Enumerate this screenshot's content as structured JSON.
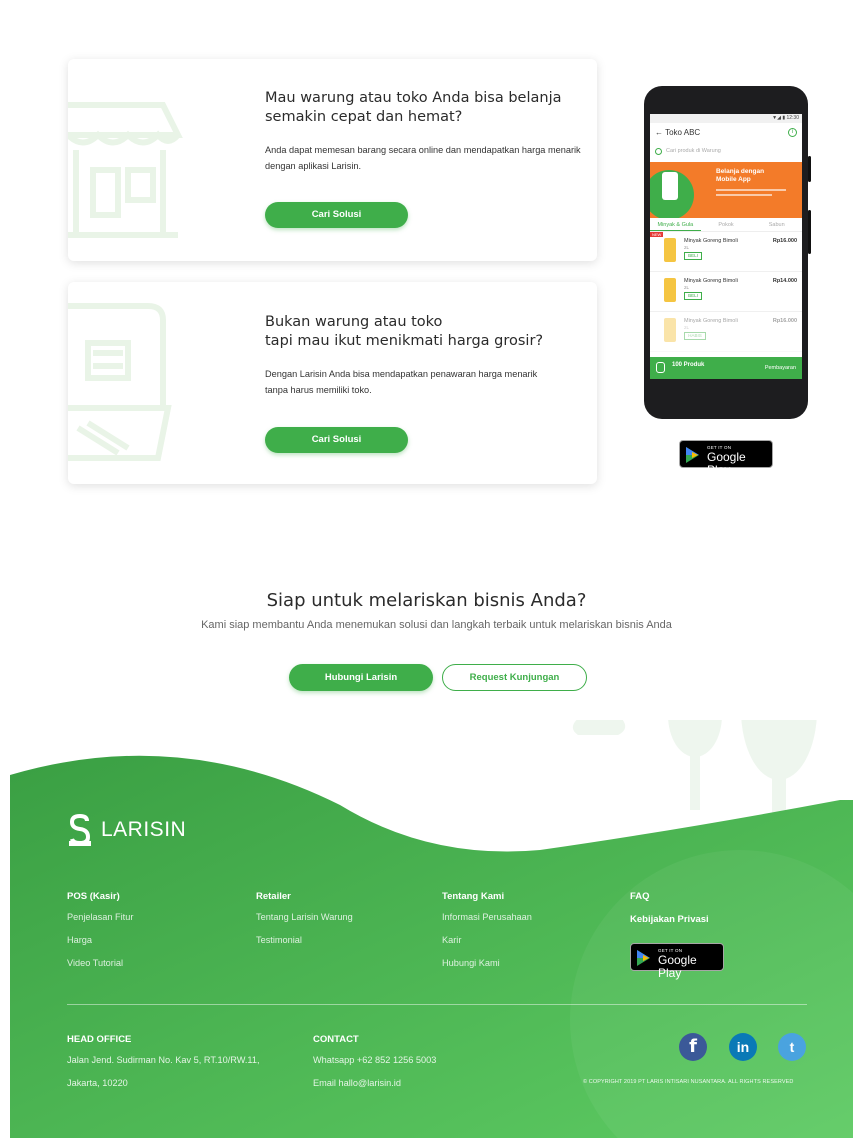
{
  "cards": [
    {
      "title": "Mau warung atau toko Anda bisa belanja\nsemakin cepat dan hemat?",
      "body": "Anda dapat memesan barang secara online dan mendapatkan harga menarik\ndengan aplikasi Larisin.",
      "button": "Cari Solusi"
    },
    {
      "title": "Bukan warung atau toko\ntapi mau ikut menikmati harga grosir?",
      "body": "Dengan Larisin Anda bisa mendapatkan penawaran harga menarik\ntanpa harus memiliki toko.",
      "button": "Cari Solusi"
    }
  ],
  "phone": {
    "status": "▼◢ ▮ 12:30",
    "store_name": "← Toko ABC",
    "search_placeholder": "Cari produk di Warung",
    "banner_title": "Belanja dengan\nMobile App",
    "tabs": [
      "Minyak & Gula",
      "Pokok",
      "Sabun"
    ],
    "products": [
      {
        "name": "Minyak Goreng Bimoli",
        "price": "Rp16.000",
        "size": "2L",
        "action": "BELI",
        "badge": "NEW"
      },
      {
        "name": "Minyak Goreng Bimoli",
        "price": "Rp14.000",
        "size": "2L",
        "action": "BELI"
      },
      {
        "name": "Minyak Goreng Bimoli",
        "price": "Rp16.000",
        "size": "2L",
        "action": "HABIS"
      }
    ],
    "cart_count": "100 Produk",
    "cart_action": "Pembayaran"
  },
  "google_play": {
    "small": "GET IT ON",
    "big": "Google Play"
  },
  "cta": {
    "title": "Siap untuk melariskan bisnis Anda?",
    "subtitle": "Kami siap membantu Anda menemukan solusi dan langkah terbaik untuk melariskan bisnis Anda",
    "primary": "Hubungi Larisin",
    "secondary": "Request Kunjungan"
  },
  "footer": {
    "brand": "LARISIN",
    "columns": [
      {
        "heading": "POS (Kasir)",
        "items": [
          "Penjelasan Fitur",
          "Harga",
          "Video Tutorial"
        ]
      },
      {
        "heading": "Retailer",
        "items": [
          "Tentang Larisin Warung",
          "Testimonial"
        ]
      },
      {
        "heading": "Tentang Kami",
        "items": [
          "Informasi Perusahaan",
          "Karir",
          "Hubungi Kami"
        ]
      },
      {
        "heading": "FAQ",
        "heading2": "Kebijakan Privasi"
      }
    ],
    "head_office": {
      "heading": "HEAD OFFICE",
      "line1": "Jalan Jend. Sudirman No. Kav 5, RT.10/RW.11,",
      "line2": "Jakarta, 10220"
    },
    "contact": {
      "heading": "CONTACT",
      "line1": "Whatsapp  +62 852 1256 5003",
      "line2": "Email  hallo@larisin.id"
    },
    "social": {
      "facebook": "f",
      "linkedin": "in",
      "twitter": "t"
    },
    "copyright": "© COPYRIGHT 2019 PT LARIS INTISARI NUSANTARA. ALL RIGHTS RESERVED"
  },
  "colors": {
    "green": "#3fae4a",
    "footer_green": "#48b24f",
    "orange": "#f37b29"
  }
}
